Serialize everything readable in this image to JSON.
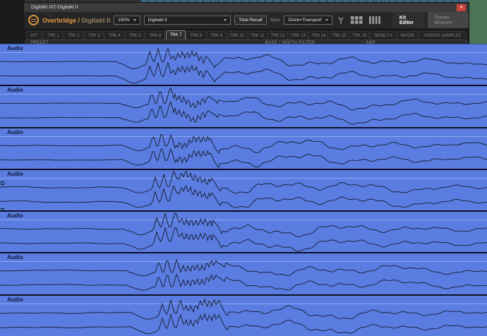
{
  "icons": {
    "close": "✕",
    "chevron_down": "css-triangle",
    "elektron_logo": "orange-ring",
    "midi_routing": "branch",
    "pad_grid": "grid-3x2",
    "track_levels": "bars-4",
    "loop_marker": "square-outline"
  },
  "colors": {
    "clip_blue": "#5b7de1",
    "waveform": "#1a2238",
    "lane_separator": "#0b1024",
    "accent_orange": "#df9a44",
    "device_tan": "#97825f",
    "close_red": "#c9453a",
    "desktop_green": "#4a7454",
    "ruler_teal": "#3b697f"
  },
  "titlebar": {
    "title": "Digitakt II/2-Digitakt II"
  },
  "toolbar": {
    "brand": "Overbridge",
    "separator": "/",
    "device": "Digitakt II",
    "zoom_value": "100%",
    "device_select_value": "Digitakt II",
    "total_recall_label": "Total Recall",
    "sync_label": "Sync",
    "sync_value": "Clock+Transport",
    "kit_editor_label": "Kit Editor",
    "preset_browser_label": "Preset Browser"
  },
  "tabs": {
    "active": "TRK 7",
    "items": [
      "KIT",
      "TRK 1",
      "TRK 2",
      "TRK 3",
      "TRK 4",
      "TRK 5",
      "TRK 6",
      "TRK 7",
      "TRK 8",
      "TRK 9",
      "TRK 10",
      "TRK 11",
      "TRK 12",
      "TRK 13",
      "TRK 14",
      "TRK 15",
      "TRK 16",
      "SEND FX",
      "MIXER",
      "ASSIGN SAMPLES"
    ]
  },
  "panels": [
    "PRESET",
    "BASE / WIDTH FILTER",
    "AMP"
  ],
  "lanes": {
    "label": "Audio",
    "items": [
      {
        "seed": 1,
        "offset": 0,
        "left_noise": 0.35,
        "markers": []
      },
      {
        "seed": 2,
        "offset": 3,
        "left_noise": 0.3,
        "markers": []
      },
      {
        "seed": 3,
        "offset": 5,
        "left_noise": 0.5,
        "markers": []
      },
      {
        "seed": 4,
        "offset": 8,
        "left_noise": 1,
        "markers": [
          16,
          54
        ]
      },
      {
        "seed": 5,
        "offset": 10,
        "left_noise": 0.8,
        "markers": []
      },
      {
        "seed": 6,
        "offset": 13,
        "left_noise": 0.6,
        "markers": []
      },
      {
        "seed": 7,
        "offset": 18,
        "left_noise": 1,
        "markers": []
      }
    ]
  }
}
